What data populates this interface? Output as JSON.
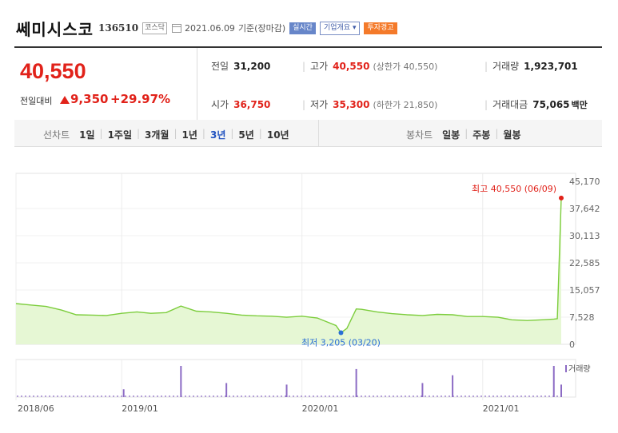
{
  "header": {
    "name": "쎄미시스코",
    "code": "136510",
    "market": "코스닥",
    "date": "2021.06.09",
    "date_suffix": "기준(장마감)",
    "tag_realtime": "실시간",
    "tag_company": "기업개요 ▾",
    "tag_warning": "투자경고"
  },
  "price": {
    "current": "40,550",
    "change_label": "전일대비",
    "change": "9,350",
    "change_pct": "+29.97%",
    "prev_label": "전일",
    "prev": "31,200",
    "open_label": "시가",
    "open": "36,750",
    "high_label": "고가",
    "high": "40,550",
    "high_limit": "(상한가 40,550)",
    "low_label": "저가",
    "low": "35,300",
    "low_limit": "(하한가 21,850)",
    "volume_label": "거래량",
    "volume": "1,923,701",
    "amount_label": "거래대금",
    "amount": "75,065",
    "amount_unit": "백만"
  },
  "period_bar": {
    "line_label": "선차트",
    "periods": [
      "1일",
      "1주일",
      "3개월",
      "1년",
      "3년",
      "5년",
      "10년"
    ],
    "active_period": "3년",
    "candle_label": "봉차트",
    "candles": [
      "일봉",
      "주봉",
      "월봉"
    ]
  },
  "chart_data": {
    "type": "area",
    "y_ticks": [
      "45,170",
      "37,642",
      "30,113",
      "22,585",
      "15,057",
      "7,528",
      "0"
    ],
    "ylim": [
      0,
      45170
    ],
    "x_tick_labels": [
      "2018/06",
      "2019/01",
      "2020/01",
      "2021/01"
    ],
    "x_tick_dates": [
      "2018-06-01",
      "2019-01-01",
      "2020-01-01",
      "2021-01-01"
    ],
    "x_range": [
      "2018-06-01",
      "2021-06-09"
    ],
    "max_annotation": "최고 40,550 (06/09)",
    "min_annotation": "최저 3,205 (03/20)",
    "max_point": {
      "date": "2021-06-09",
      "value": 40550
    },
    "min_point": {
      "date": "2020-03-20",
      "value": 3205
    },
    "colors": {
      "line": "#7ccd3c",
      "fill": "#e6f7d4",
      "max": "#e1221a",
      "min": "#2a6fd6",
      "volume": "#8c6bc4"
    },
    "volume_label": "거래량",
    "series": [
      {
        "x": [
          "2018-06-01",
          "2018-07-01",
          "2018-08-01",
          "2018-09-01",
          "2018-10-01",
          "2018-11-01",
          "2018-12-01",
          "2019-01-01",
          "2019-02-01",
          "2019-03-01",
          "2019-04-01",
          "2019-05-01",
          "2019-06-01",
          "2019-07-01",
          "2019-08-01",
          "2019-09-01",
          "2019-10-01",
          "2019-11-01",
          "2019-12-01",
          "2020-01-01",
          "2020-02-01",
          "2020-03-10",
          "2020-03-20",
          "2020-04-01",
          "2020-04-20",
          "2020-05-01",
          "2020-06-01",
          "2020-07-01",
          "2020-08-01",
          "2020-09-01",
          "2020-10-01",
          "2020-11-01",
          "2020-12-01",
          "2021-01-01",
          "2021-02-01",
          "2021-03-01",
          "2021-04-01",
          "2021-05-01",
          "2021-05-25",
          "2021-06-01",
          "2021-06-09"
        ],
        "values": [
          11300,
          10900,
          10500,
          9500,
          8200,
          8100,
          8000,
          8600,
          9000,
          8600,
          8800,
          10600,
          9200,
          9000,
          8600,
          8100,
          7900,
          7800,
          7500,
          7800,
          7300,
          5200,
          3205,
          4400,
          9800,
          9700,
          9000,
          8500,
          8200,
          8000,
          8300,
          8200,
          7700,
          7700,
          7500,
          6800,
          6600,
          6800,
          7000,
          7100,
          40550
        ]
      }
    ],
    "volume_spikes": [
      {
        "date": "2019-05-01",
        "rel": 1.0
      },
      {
        "date": "2020-11-01",
        "rel": 0.7
      },
      {
        "date": "2021-05-25",
        "rel": 1.0
      },
      {
        "date": "2019-01-05",
        "rel": 0.25
      },
      {
        "date": "2019-08-01",
        "rel": 0.45
      },
      {
        "date": "2019-12-01",
        "rel": 0.4
      },
      {
        "date": "2020-04-20",
        "rel": 0.9
      },
      {
        "date": "2020-09-01",
        "rel": 0.45
      },
      {
        "date": "2021-06-09",
        "rel": 0.4
      }
    ]
  }
}
